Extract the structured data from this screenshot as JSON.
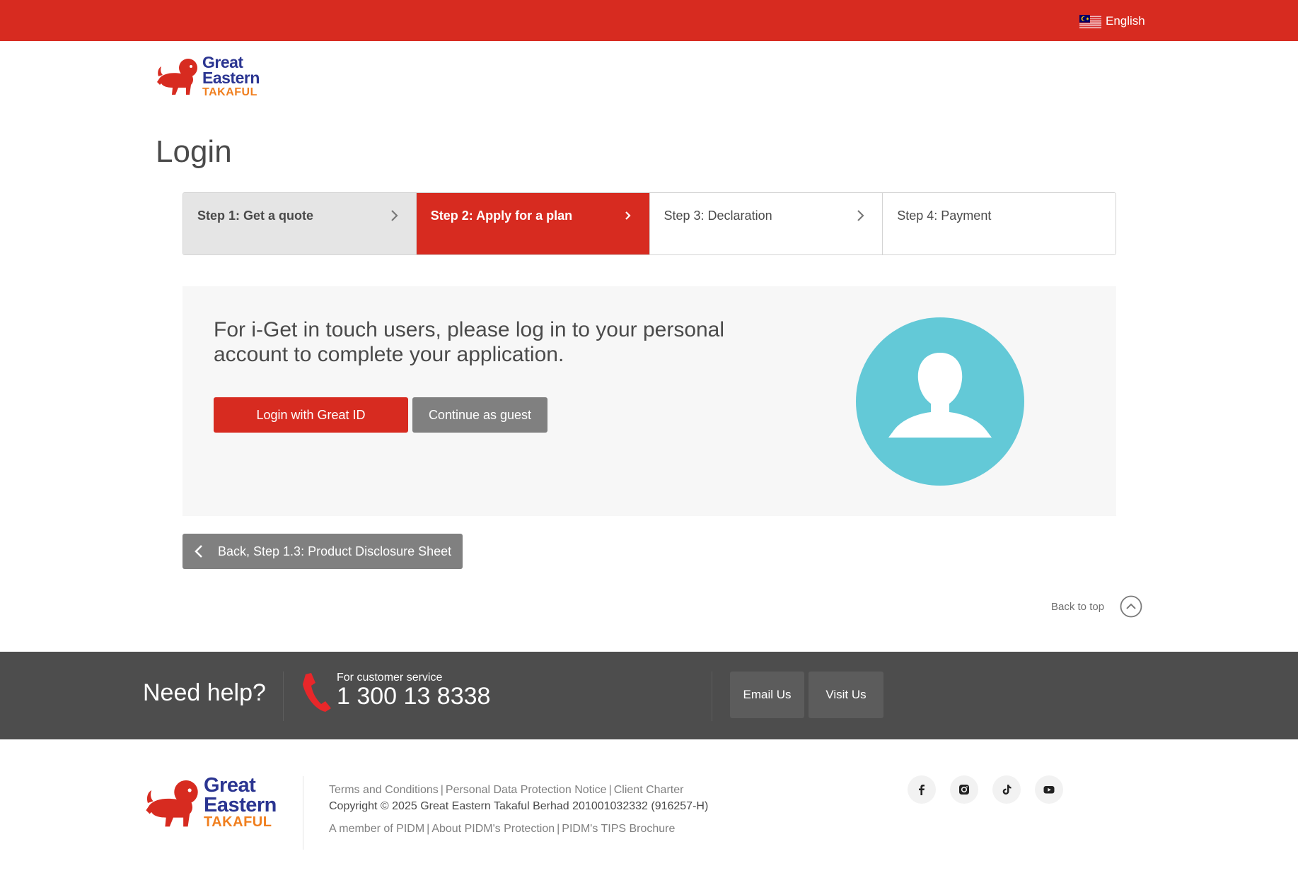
{
  "topbar": {
    "language": "English"
  },
  "logo": {
    "line1": "Great",
    "line2": "Eastern",
    "line3": "TAKAFUL"
  },
  "page": {
    "title": "Login"
  },
  "stepper": [
    {
      "label": "Step 1: Get a quote",
      "state": "done"
    },
    {
      "label": "Step 2: Apply for a plan",
      "state": "active"
    },
    {
      "label": "Step 3: Declaration",
      "state": "todo"
    },
    {
      "label": "Step 4: Payment",
      "state": "todo"
    }
  ],
  "panel": {
    "message": "For i-Get in touch users, please log in to your personal account to complete your application.",
    "login_button": "Login with Great ID",
    "guest_button": "Continue as guest",
    "avatar_icon": "user-icon"
  },
  "back_button": "Back, Step 1.3: Product Disclosure Sheet",
  "back_to_top": "Back to top",
  "help": {
    "title": "Need help?",
    "cs_label": "For customer service",
    "cs_number": "1 300 13 8338",
    "email_button": "Email Us",
    "visit_button": "Visit Us"
  },
  "footer": {
    "links": [
      "Terms and Conditions",
      "Personal Data Protection Notice",
      "Client Charter"
    ],
    "copyright": "Copyright © 2025 Great Eastern Takaful Berhad 201001032332 (916257-H)",
    "pidm_links": [
      "A member of PIDM",
      "About PIDM's Protection",
      "PIDM's TIPS Brochure"
    ],
    "social": [
      "facebook-icon",
      "instagram-icon",
      "tiktok-icon",
      "youtube-icon"
    ]
  },
  "colors": {
    "brand_red": "#d72b20",
    "brand_blue": "#2b3591",
    "brand_orange": "#f07f1f",
    "avatar_teal": "#63c9d7",
    "help_bar": "#4d4d4d"
  }
}
